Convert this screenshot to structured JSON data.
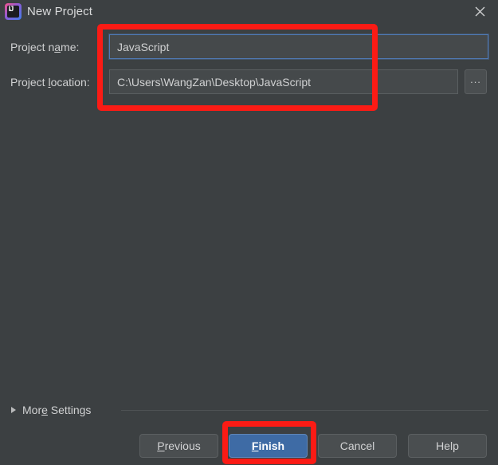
{
  "window": {
    "title": "New Project",
    "app_icon": "intellij-idea-icon",
    "close_icon": "close-icon",
    "background_color": "#3c4042"
  },
  "form": {
    "name_row": {
      "label_before": "Project n",
      "label_mnemonic": "a",
      "label_after": "me:",
      "value": "JavaScript",
      "placeholder": "",
      "focus_color": "#4f7ab5"
    },
    "location_row": {
      "label_before": "Project ",
      "label_mnemonic": "l",
      "label_after": "ocation:",
      "value": "C:\\Users\\WangZan\\Desktop\\JavaScript",
      "placeholder": "",
      "browse_label": "..."
    }
  },
  "more_settings": {
    "label_before": "Mor",
    "label_mnemonic": "e",
    "label_after": " Settings",
    "expanded": false,
    "arrow_icon": "chevron-right-icon"
  },
  "buttons": {
    "previous": {
      "before": "",
      "mnemonic": "P",
      "after": "revious"
    },
    "finish": {
      "before": "",
      "mnemonic": "F",
      "after": "inish"
    },
    "cancel": {
      "before": "Cancel",
      "mnemonic": "",
      "after": ""
    },
    "help": {
      "before": "Help",
      "mnemonic": "",
      "after": ""
    }
  },
  "annotations": {
    "color": "#fb1b15",
    "fields_highlight": "red-box-around-project-fields",
    "finish_highlight": "red-box-around-finish-button"
  }
}
